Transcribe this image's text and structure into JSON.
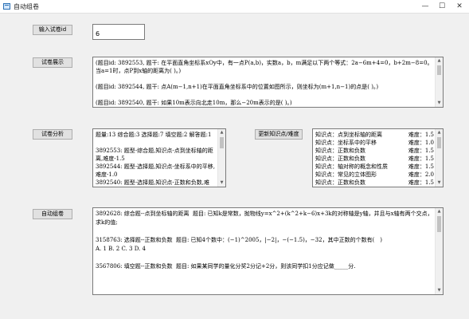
{
  "window": {
    "title": "自动组卷",
    "minimize": "—",
    "maximize": "☐",
    "close": "✕"
  },
  "input_section": {
    "button_label": "输入试卷id",
    "value": "6"
  },
  "display_section": {
    "button_label": "试卷展示",
    "content": "(题目id: 3892553, 题干: 在平面直角坐标系xOy中，有一点P(a,b)，实数a，b，m满足以下两个等式：2a−6m+4=0，b+2m−8=0。当a=1时，点P到x轴的距离为( )。)\n\n(题目id: 3892544, 题干: 点A(m−1,n+1)在平面直角坐标系中的位置如图所示，则坐标为(m+1,n−1)的点是( )。)\n\n(题目id: 3892540, 题干: 如果10m表示向北走10m，那么−20m表示的是( )。)"
  },
  "analysis_section": {
    "button_label": "试卷分析",
    "content": "题量:13 综合题:3 选择题:7 填空题:2 解答题:1\n\n3892553: 题型-综合题,知识点-点到坐标轴的距离,难度-1.5\n3892544: 题型-选择题,知识点-坐标系中的平移,难度-1.0\n3892540: 题型-选择题,知识点-正数和负数,难"
  },
  "update_section": {
    "button_label": "更新知识点/难度",
    "rows": [
      {
        "kp": "知识点：点到坐标轴的距离",
        "diff": "难度：1.5"
      },
      {
        "kp": "知识点：坐标系中的平移",
        "diff": "难度：1.0"
      },
      {
        "kp": "知识点：正数和负数",
        "diff": "难度：1.5"
      },
      {
        "kp": "知识点：正数和负数",
        "diff": "难度：1.5"
      },
      {
        "kp": "知识点：轴对称的概念和性质",
        "diff": "难度：1.5"
      },
      {
        "kp": "知识点：常见的立体图形",
        "diff": "难度：2.0"
      },
      {
        "kp": "知识点：正数和负数",
        "diff": "难度：1.5"
      }
    ]
  },
  "auto_section": {
    "button_label": "自动组卷",
    "content": "3892628: 综合题--点到坐标轴的距离  题目: 已知k是常数，抛物线y=x^2+(k^2+k−6)x+3k的对称轴是y轴，并且与x轴有两个交点，求k的值;\n\n3158763: 选择题--正数和负数  题目: 已知4个数中：(−1)^2005，|−2|，−(−1.5)，−32，其中正数的个数有(　)\nA. 1 B. 2 C. 3 D. 4\n\n3567806: 填空题--正数和负数  题目: 如果某同学的量化分奖2分记+2分，则该同学扣1分应记做_____分."
  },
  "scroll_arrows": {
    "up": "▲",
    "down": "▼"
  }
}
